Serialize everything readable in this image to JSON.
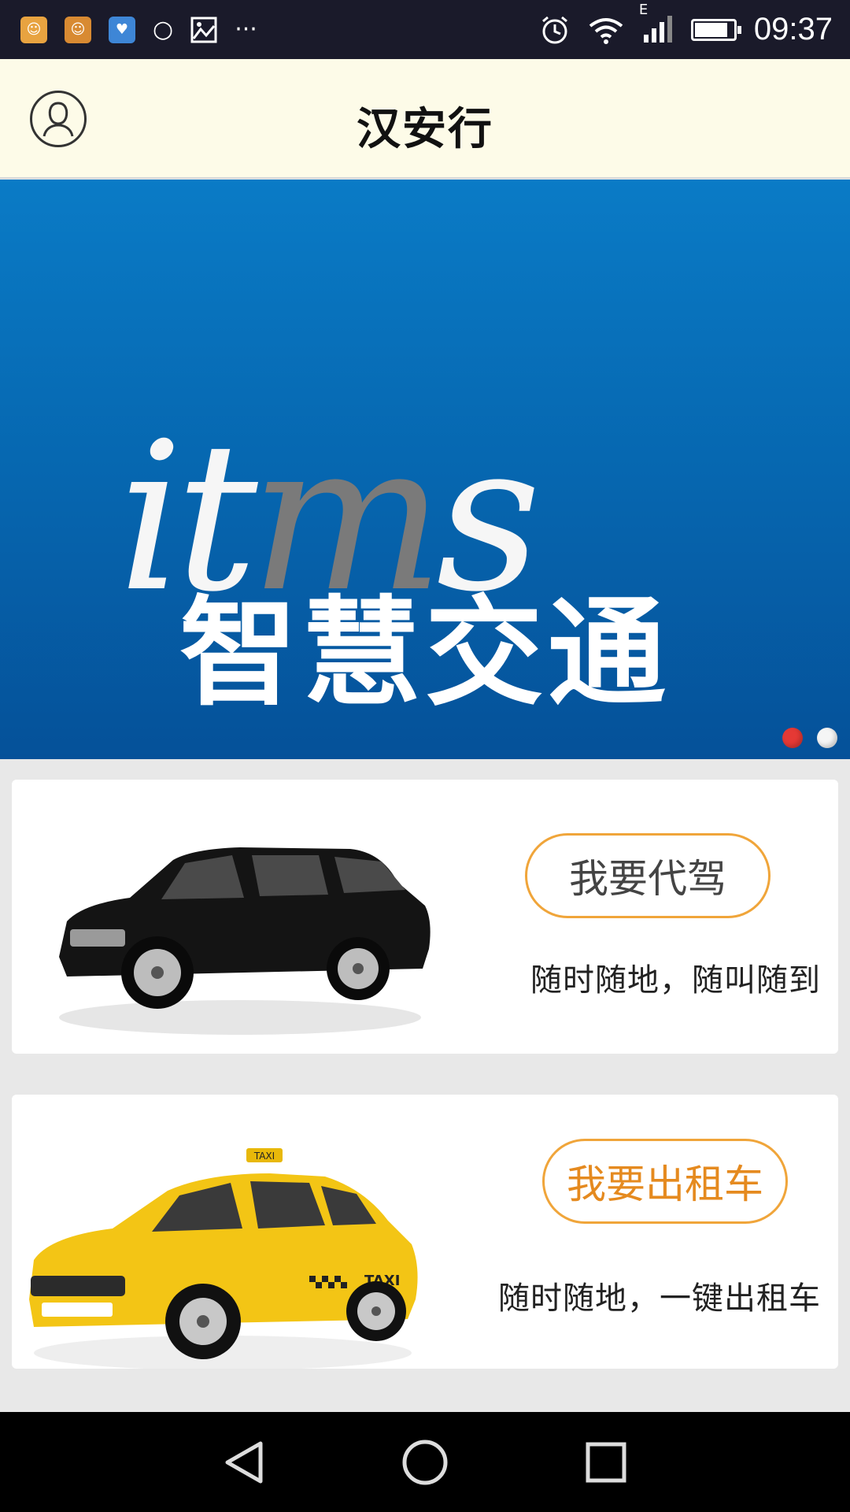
{
  "status_bar": {
    "time": "09:37",
    "network_type": "E",
    "icons": [
      "app-icon",
      "app-icon",
      "health-icon",
      "chat-icon",
      "image-icon",
      "more-icon",
      "alarm-icon",
      "wifi-icon",
      "signal-icon",
      "battery-icon"
    ],
    "overflow": "···"
  },
  "header": {
    "title": "汉安行",
    "profile_icon": "user-profile-icon"
  },
  "banner": {
    "logo": {
      "part1": "it",
      "part2": "m",
      "part3": "s"
    },
    "subtitle": "智慧交通",
    "active_slide": 1,
    "slide_count": 2,
    "dot_colors": {
      "active": "#e53935",
      "inactive": "#f5f5f5"
    }
  },
  "services": [
    {
      "button_label": "我要代驾",
      "tagline": "随时随地，随叫随到",
      "image": "black-suv"
    },
    {
      "button_label": "我要出租车",
      "tagline": "随时随地，一键出租车",
      "image": "yellow-taxi",
      "taxi_sign": "TAXI"
    }
  ],
  "colors": {
    "accent": "#f0a53a",
    "header_bg": "#fdfbe8",
    "banner_blue": "#0667b0"
  },
  "nav": {
    "back": "back-icon",
    "home": "home-icon",
    "recents": "recents-icon"
  }
}
